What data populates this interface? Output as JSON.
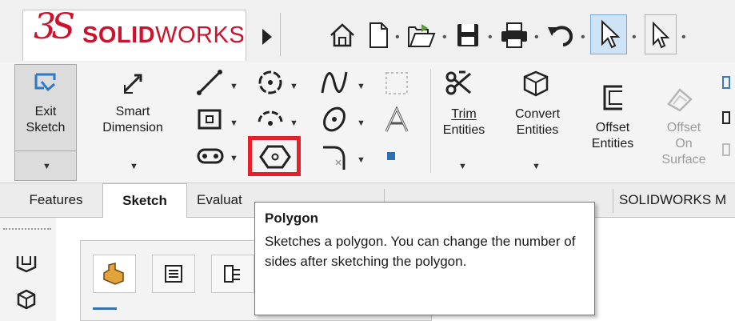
{
  "app": {
    "logo_ds": "3S",
    "logo_solid": "SOLID",
    "logo_works": "WORKS",
    "brand_color": "#d0112b"
  },
  "quick_access": {
    "icons": [
      "home-icon",
      "new-document-icon",
      "open-file-icon",
      "save-icon",
      "print-icon",
      "undo-icon",
      "select-cursor-icon"
    ]
  },
  "ribbon": {
    "exit_sketch": "Exit\nSketch",
    "exit_line1": "Exit",
    "exit_line2": "Sketch",
    "smart_line1": "Smart",
    "smart_line2": "Dimension",
    "trim_line1": "Trim",
    "trim_line2": "Entities",
    "convert_line1": "Convert",
    "convert_line2": "Entities",
    "offset_line1": "Offset",
    "offset_line2": "Entities",
    "offset_surface_line1": "Offset",
    "offset_surface_line2": "On",
    "offset_surface_line3": "Surface",
    "highlight_color": "#e5202b"
  },
  "tabs": {
    "features": "Features",
    "sketch": "Sketch",
    "evaluate": "Evaluat",
    "solidworks_m": "SOLIDWORKS M"
  },
  "tooltip": {
    "title": "Polygon",
    "body": "Sketches a polygon. You can change the number of sides after sketching the polygon."
  }
}
